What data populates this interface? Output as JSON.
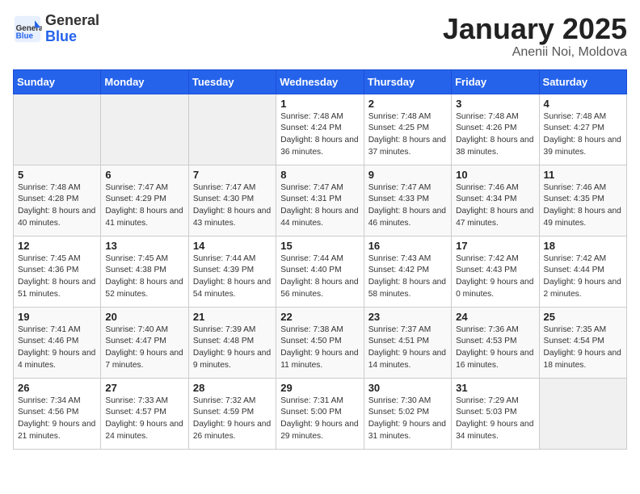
{
  "header": {
    "logo_general": "General",
    "logo_blue": "Blue",
    "month_year": "January 2025",
    "location": "Anenii Noi, Moldova"
  },
  "weekdays": [
    "Sunday",
    "Monday",
    "Tuesday",
    "Wednesday",
    "Thursday",
    "Friday",
    "Saturday"
  ],
  "weeks": [
    [
      {
        "day": "",
        "content": ""
      },
      {
        "day": "",
        "content": ""
      },
      {
        "day": "",
        "content": ""
      },
      {
        "day": "1",
        "content": "Sunrise: 7:48 AM\nSunset: 4:24 PM\nDaylight: 8 hours and 36 minutes."
      },
      {
        "day": "2",
        "content": "Sunrise: 7:48 AM\nSunset: 4:25 PM\nDaylight: 8 hours and 37 minutes."
      },
      {
        "day": "3",
        "content": "Sunrise: 7:48 AM\nSunset: 4:26 PM\nDaylight: 8 hours and 38 minutes."
      },
      {
        "day": "4",
        "content": "Sunrise: 7:48 AM\nSunset: 4:27 PM\nDaylight: 8 hours and 39 minutes."
      }
    ],
    [
      {
        "day": "5",
        "content": "Sunrise: 7:48 AM\nSunset: 4:28 PM\nDaylight: 8 hours and 40 minutes."
      },
      {
        "day": "6",
        "content": "Sunrise: 7:47 AM\nSunset: 4:29 PM\nDaylight: 8 hours and 41 minutes."
      },
      {
        "day": "7",
        "content": "Sunrise: 7:47 AM\nSunset: 4:30 PM\nDaylight: 8 hours and 43 minutes."
      },
      {
        "day": "8",
        "content": "Sunrise: 7:47 AM\nSunset: 4:31 PM\nDaylight: 8 hours and 44 minutes."
      },
      {
        "day": "9",
        "content": "Sunrise: 7:47 AM\nSunset: 4:33 PM\nDaylight: 8 hours and 46 minutes."
      },
      {
        "day": "10",
        "content": "Sunrise: 7:46 AM\nSunset: 4:34 PM\nDaylight: 8 hours and 47 minutes."
      },
      {
        "day": "11",
        "content": "Sunrise: 7:46 AM\nSunset: 4:35 PM\nDaylight: 8 hours and 49 minutes."
      }
    ],
    [
      {
        "day": "12",
        "content": "Sunrise: 7:45 AM\nSunset: 4:36 PM\nDaylight: 8 hours and 51 minutes."
      },
      {
        "day": "13",
        "content": "Sunrise: 7:45 AM\nSunset: 4:38 PM\nDaylight: 8 hours and 52 minutes."
      },
      {
        "day": "14",
        "content": "Sunrise: 7:44 AM\nSunset: 4:39 PM\nDaylight: 8 hours and 54 minutes."
      },
      {
        "day": "15",
        "content": "Sunrise: 7:44 AM\nSunset: 4:40 PM\nDaylight: 8 hours and 56 minutes."
      },
      {
        "day": "16",
        "content": "Sunrise: 7:43 AM\nSunset: 4:42 PM\nDaylight: 8 hours and 58 minutes."
      },
      {
        "day": "17",
        "content": "Sunrise: 7:42 AM\nSunset: 4:43 PM\nDaylight: 9 hours and 0 minutes."
      },
      {
        "day": "18",
        "content": "Sunrise: 7:42 AM\nSunset: 4:44 PM\nDaylight: 9 hours and 2 minutes."
      }
    ],
    [
      {
        "day": "19",
        "content": "Sunrise: 7:41 AM\nSunset: 4:46 PM\nDaylight: 9 hours and 4 minutes."
      },
      {
        "day": "20",
        "content": "Sunrise: 7:40 AM\nSunset: 4:47 PM\nDaylight: 9 hours and 7 minutes."
      },
      {
        "day": "21",
        "content": "Sunrise: 7:39 AM\nSunset: 4:48 PM\nDaylight: 9 hours and 9 minutes."
      },
      {
        "day": "22",
        "content": "Sunrise: 7:38 AM\nSunset: 4:50 PM\nDaylight: 9 hours and 11 minutes."
      },
      {
        "day": "23",
        "content": "Sunrise: 7:37 AM\nSunset: 4:51 PM\nDaylight: 9 hours and 14 minutes."
      },
      {
        "day": "24",
        "content": "Sunrise: 7:36 AM\nSunset: 4:53 PM\nDaylight: 9 hours and 16 minutes."
      },
      {
        "day": "25",
        "content": "Sunrise: 7:35 AM\nSunset: 4:54 PM\nDaylight: 9 hours and 18 minutes."
      }
    ],
    [
      {
        "day": "26",
        "content": "Sunrise: 7:34 AM\nSunset: 4:56 PM\nDaylight: 9 hours and 21 minutes."
      },
      {
        "day": "27",
        "content": "Sunrise: 7:33 AM\nSunset: 4:57 PM\nDaylight: 9 hours and 24 minutes."
      },
      {
        "day": "28",
        "content": "Sunrise: 7:32 AM\nSunset: 4:59 PM\nDaylight: 9 hours and 26 minutes."
      },
      {
        "day": "29",
        "content": "Sunrise: 7:31 AM\nSunset: 5:00 PM\nDaylight: 9 hours and 29 minutes."
      },
      {
        "day": "30",
        "content": "Sunrise: 7:30 AM\nSunset: 5:02 PM\nDaylight: 9 hours and 31 minutes."
      },
      {
        "day": "31",
        "content": "Sunrise: 7:29 AM\nSunset: 5:03 PM\nDaylight: 9 hours and 34 minutes."
      },
      {
        "day": "",
        "content": ""
      }
    ]
  ]
}
